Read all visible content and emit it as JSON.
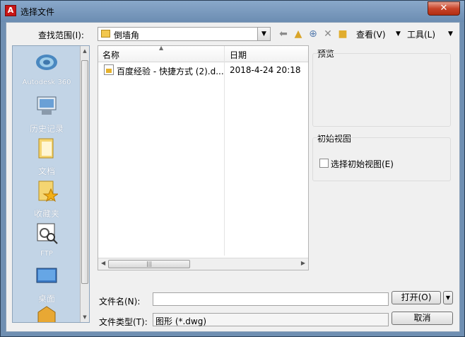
{
  "window": {
    "title": "选择文件",
    "close_glyph": "✕"
  },
  "toolbar": {
    "lookin_label": "查找范围(I):",
    "lookin_value": "倒墙角",
    "view_label": "查看(V)",
    "tools_label": "工具(L)"
  },
  "places": [
    {
      "label": "Autodesk 360",
      "icon": "cloud-icon"
    },
    {
      "label": "历史记录",
      "icon": "history-icon"
    },
    {
      "label": "文档",
      "icon": "documents-folder-icon"
    },
    {
      "label": "收藏夹",
      "icon": "favorites-folder-icon"
    },
    {
      "label": "FTP",
      "icon": "ftp-icon"
    },
    {
      "label": "桌面",
      "icon": "desktop-icon"
    }
  ],
  "filelist": {
    "col_name": "名称",
    "col_date": "日期",
    "rows": [
      {
        "name": "百度经验 - 快捷方式 (2).d...",
        "date": "2018-4-24 20:18"
      }
    ]
  },
  "preview": {
    "title": "预览"
  },
  "initial_view": {
    "title": "初始视图",
    "checkbox_label": "选择初始视图(E)"
  },
  "bottom": {
    "filename_label": "文件名(N):",
    "filename_value": "",
    "filetype_label": "文件类型(T):",
    "filetype_value": "图形 (*.dwg)",
    "open_label": "打开(O)",
    "cancel_label": "取消"
  },
  "colors": {
    "title_bar": "#7595b9",
    "places_bg": "#c2d4e6",
    "close_button": "#c8442a"
  }
}
